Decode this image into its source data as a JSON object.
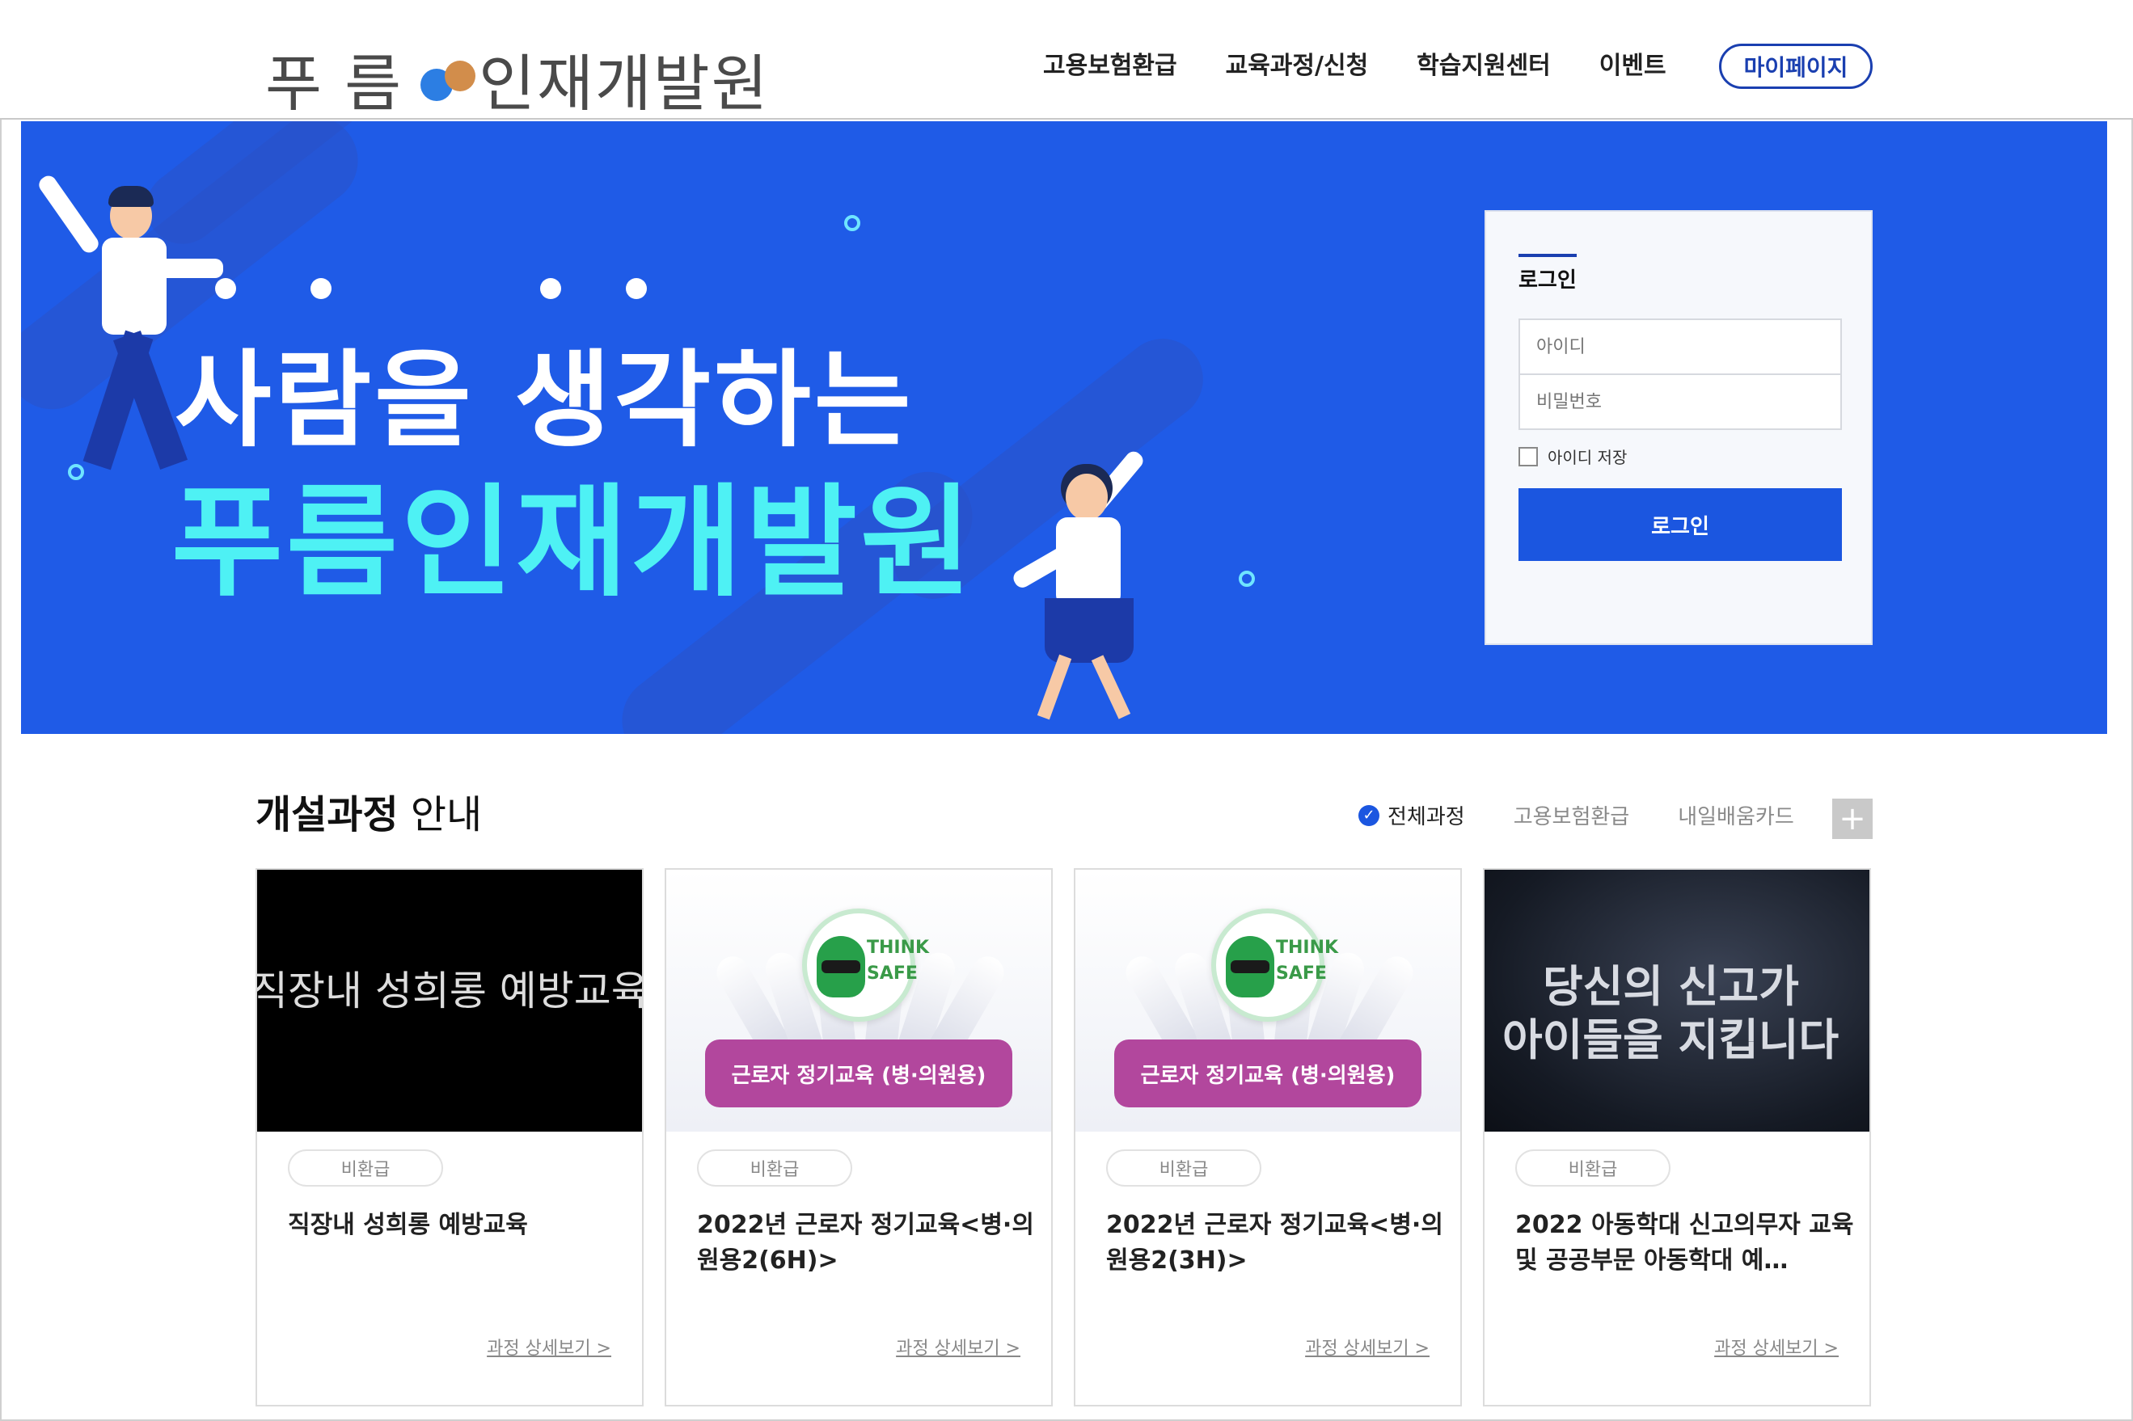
{
  "header": {
    "logo_left": "푸 름",
    "logo_right": "인재개발원",
    "nav": [
      "고용보험환급",
      "교육과정/신청",
      "학습지원센터",
      "이벤트"
    ],
    "mypage_label": "마이페이지"
  },
  "hero": {
    "line1": "사람을 생각하는",
    "line2": "푸름인재개발원"
  },
  "login": {
    "title": "로그인",
    "id_placeholder": "아이디",
    "pw_placeholder": "비밀번호",
    "remember_label": "아이디 저장",
    "button_label": "로그인"
  },
  "courses_section": {
    "title_bold": "개설과정",
    "title_rest": " 안내",
    "filters": [
      "전체과정",
      "고용보험환급",
      "내일배움카드"
    ],
    "active_filter": "전체과정",
    "more_label": "+"
  },
  "cards": [
    {
      "thumb_text": "직장내 성희롱 예방교육",
      "tag": "비환급",
      "title": "직장내 성희롱 예방교육",
      "link": "과정 상세보기 >"
    },
    {
      "thumb_badge_top": "THINK",
      "thumb_badge_bottom": "SAFE",
      "thumb_pill": "근로자 정기교육 (병·의원용)",
      "tag": "비환급",
      "title": "2022년 근로자 정기교육<병·의원용2(6H)>",
      "link": "과정 상세보기 >"
    },
    {
      "thumb_badge_top": "THINK",
      "thumb_badge_bottom": "SAFE",
      "thumb_pill": "근로자 정기교육 (병·의원용)",
      "tag": "비환급",
      "title": "2022년 근로자 정기교육<병·의원용2(3H)>",
      "link": "과정 상세보기 >"
    },
    {
      "thumb_line1": "당신의 신고가",
      "thumb_line2": "아이들을 지킵니다",
      "tag": "비환급",
      "title": "2022 아동학대 신고의무자 교육 및 공공부문 아동학대 예…",
      "link": "과정 상세보기 >"
    }
  ],
  "colors": {
    "hero_bg": "#1f5be7",
    "hero_accent": "#4ef1f4",
    "primary_button": "#1b56e0",
    "pill": "#b2479d"
  }
}
